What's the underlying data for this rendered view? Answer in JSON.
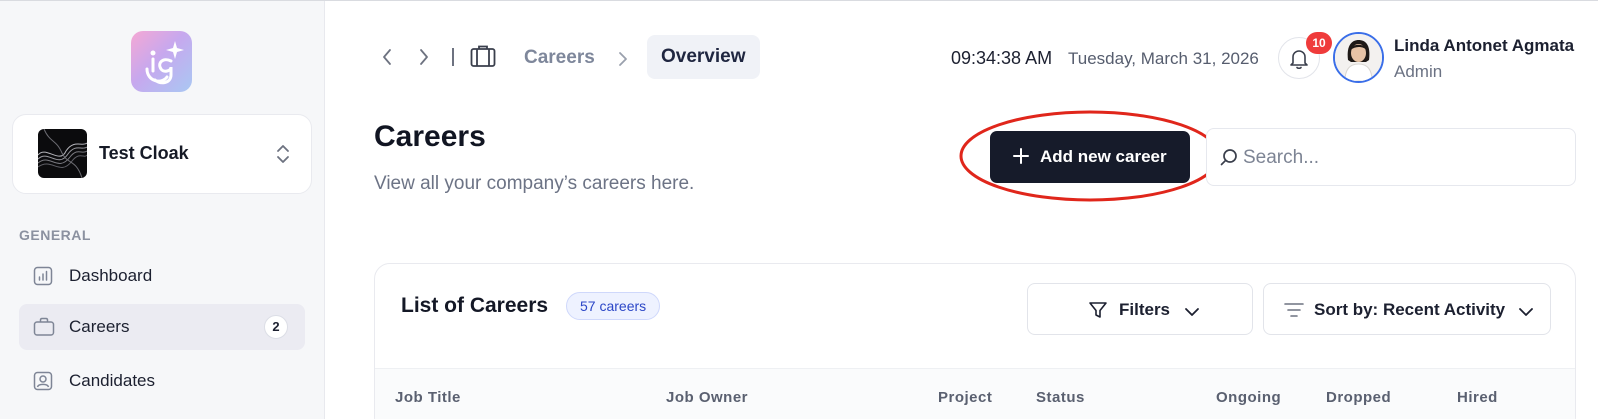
{
  "sidebar": {
    "workspace": {
      "name": "Test Cloak"
    },
    "section_label": "GENERAL",
    "items": [
      {
        "label": "Dashboard",
        "icon": "chart-icon",
        "active": false
      },
      {
        "label": "Careers",
        "icon": "briefcase-icon",
        "active": true,
        "count": "2"
      },
      {
        "label": "Candidates",
        "icon": "person-card-icon",
        "active": false
      }
    ]
  },
  "header": {
    "breadcrumb": {
      "parent": "Careers",
      "current": "Overview"
    },
    "time": "09:34:38 AM",
    "date": "Tuesday, March 31, 2026",
    "notifications_count": "10",
    "user": {
      "name": "Linda Antonet Agmata",
      "role": "Admin"
    }
  },
  "page": {
    "title": "Careers",
    "subtitle": "View all your company’s careers here.",
    "add_button_label": "Add new career",
    "search_placeholder": "Search..."
  },
  "list": {
    "title": "List of Careers",
    "count_label": "57 careers",
    "filters_label": "Filters",
    "sort_label": "Sort by: Recent Activity",
    "columns": [
      "Job Title",
      "Job Owner",
      "Project",
      "Status",
      "Ongoing",
      "Dropped",
      "Hired"
    ]
  },
  "colors": {
    "accent_dark": "#161b2a",
    "highlight_ring": "#e0261b",
    "badge_red": "#ef3b3b",
    "pill_blue": "#2c47c7"
  }
}
